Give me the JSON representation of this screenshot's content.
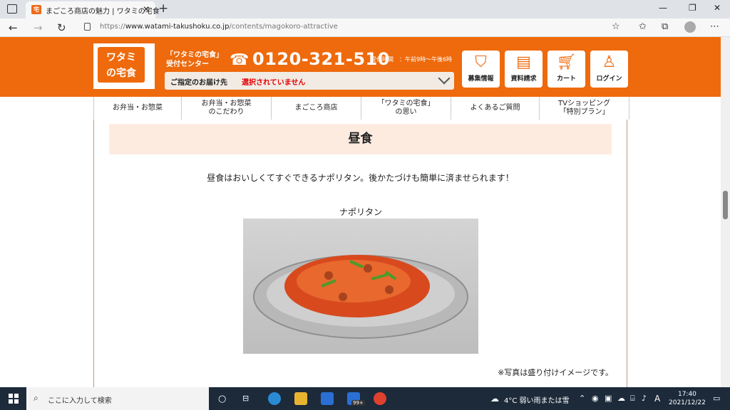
{
  "browser": {
    "tab_title": "まごころ商店の魅力 | ワタミの宅食",
    "url_prefix": "https://",
    "url_host": "www.watami-takushoku.co.jp",
    "url_path": "/contents/magokoro-attractive"
  },
  "header": {
    "logo_line1": "ワタミ",
    "logo_line2": "の宅食",
    "center_line1": "「ワタミの宅食」",
    "center_line2": "受付センター",
    "phone": "0120-321-510",
    "hours": "受付時間　：午前9時〜午後6時",
    "delivery_label": "ご指定のお届け先",
    "delivery_value": "選択されていません",
    "buttons": [
      {
        "label": "募集情報",
        "icon": "apron-icon"
      },
      {
        "label": "資料請求",
        "icon": "document-icon"
      },
      {
        "label": "カート",
        "icon": "cart-icon"
      },
      {
        "label": "ログイン",
        "icon": "person-icon"
      }
    ]
  },
  "gnav": [
    {
      "line1": "お弁当・お惣菜",
      "line2": ""
    },
    {
      "line1": "お弁当・お惣菜",
      "line2": "のこだわり"
    },
    {
      "line1": "まごころ商店",
      "line2": ""
    },
    {
      "line1": "「ワタミの宅食」",
      "line2": "の思い"
    },
    {
      "line1": "よくあるご質問",
      "line2": ""
    },
    {
      "line1": "TVショッピング",
      "line2": "「特別プラン」"
    }
  ],
  "main": {
    "section_title": "昼食",
    "lead": "昼食はおいしくてすぐできるナポリタン。後かたづけも簡単に済ませられます！",
    "photo_caption": "ナポリタン",
    "note": "※写真は盛り付けイメージです。"
  },
  "taskbar": {
    "search_placeholder": "ここに入力して検索",
    "weather": "4°C  弱い雨または雪",
    "ime": "A",
    "time": "17:40",
    "date": "2021/12/22",
    "badge": "99+"
  }
}
